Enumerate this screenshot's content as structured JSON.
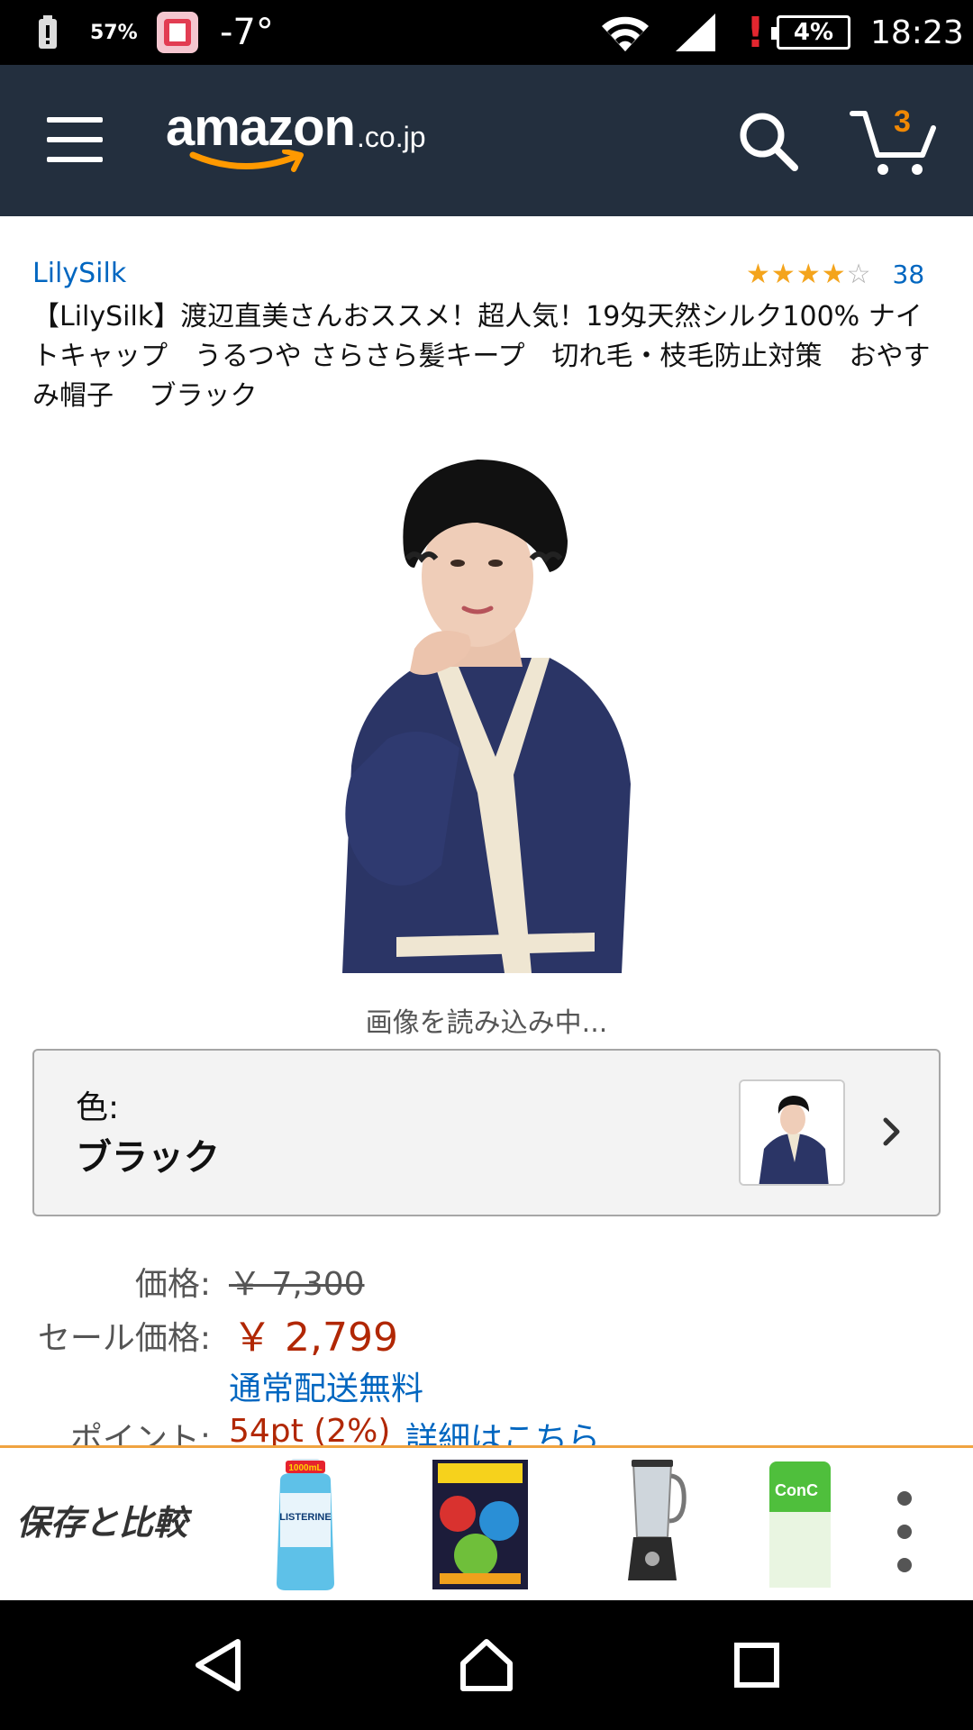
{
  "status_bar": {
    "battery_saver": "57%",
    "temperature": "-7°",
    "battery_percent": "4%",
    "time": "18:23",
    "alert": "!"
  },
  "header": {
    "logo_main": "amazon",
    "logo_suffix": ".co.jp",
    "cart_count": "3",
    "brand_color": "#232f3e",
    "accent_color": "#f08804"
  },
  "product": {
    "brand": "LilySilk",
    "rating_stars": 4,
    "rating_max": 5,
    "rating_count": "38",
    "title": "【LilySilk】渡辺直美さんおススメ！超人気！19匁天然シルク100% ナイトキャップ　うるつや さらさら髪キープ　切れ毛・枝毛防止対策　おやすみ帽子　 ブラック",
    "image_loading_text": "画像を読み込み中..."
  },
  "color_selector": {
    "label": "色:",
    "value": "ブラック"
  },
  "pricing": {
    "list_label": "価格:",
    "list_price": "￥ 7,300",
    "sale_label": "セール価格:",
    "sale_price": "￥ 2,799",
    "shipping": "通常配送無料",
    "points_label": "ポイント:",
    "points_value": "54pt  (2%)",
    "points_link": "詳細はこちら",
    "sale_color": "#b12704",
    "link_color": "#0066c0"
  },
  "compare_bar": {
    "label": "保存と比較",
    "items": [
      {
        "icon": "mouthwash-bottle-icon",
        "badge": "1000mL",
        "text": "LISTERINE"
      },
      {
        "icon": "comic-book-icon"
      },
      {
        "icon": "blender-icon"
      },
      {
        "icon": "toothpaste-icon",
        "text": "ConC"
      }
    ]
  },
  "nav_bar": {
    "back": "back-icon",
    "home": "home-icon",
    "recent": "recent-apps-icon"
  }
}
